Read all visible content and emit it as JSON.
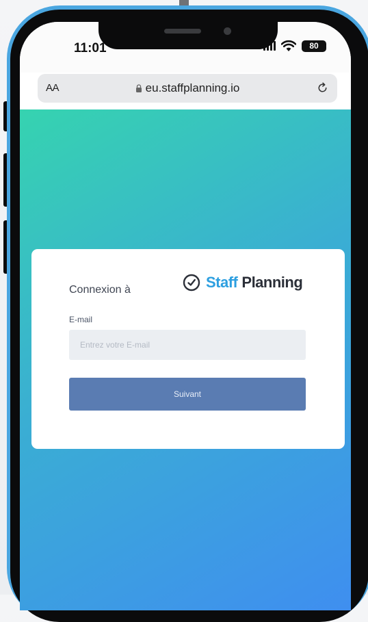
{
  "status_bar": {
    "time": "11:01",
    "battery": "80"
  },
  "browser": {
    "text_size_label": "AA",
    "url": "eu.staffplanning.io"
  },
  "login": {
    "heading": "Connexion à",
    "logo": {
      "word1": "Staff",
      "word2": "Planning"
    },
    "email_label": "E-mail",
    "email_placeholder": "Entrez votre E-mail",
    "email_value": "",
    "submit_label": "Suivant"
  },
  "colors": {
    "frame": "#4aa6e0",
    "gradient_start": "#36d3b0",
    "gradient_end": "#3f8ef0",
    "button": "#5a7cb2",
    "logo_accent": "#2d9fe0"
  }
}
